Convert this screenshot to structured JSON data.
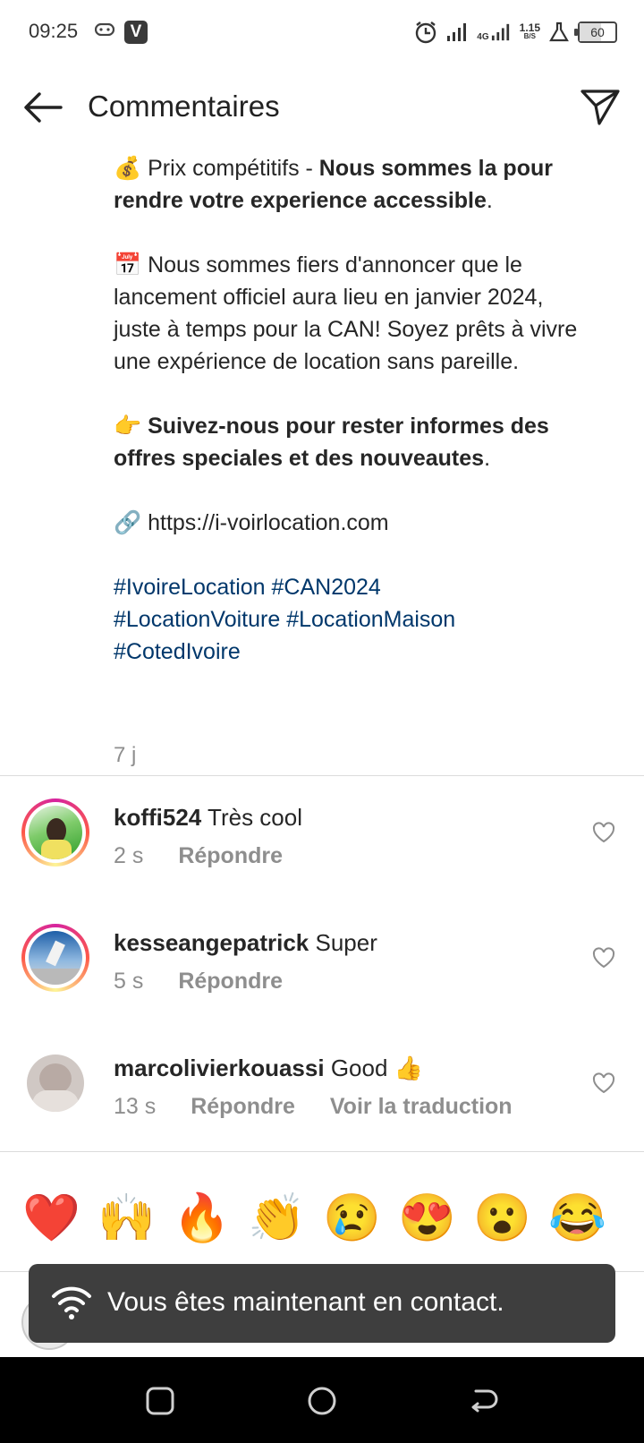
{
  "status_bar": {
    "time": "09:25",
    "app_icon_label": "V",
    "network_type": "4G",
    "speed_value": "1.15",
    "speed_unit": "B/S",
    "battery": "60",
    "icons": [
      "gamepad-icon",
      "alarm-icon",
      "signal-icon",
      "signal-4g-icon",
      "flask-icon",
      "battery-icon"
    ]
  },
  "header": {
    "title": "Commentaires",
    "back_icon": "arrow-left-icon",
    "send_icon": "paper-plane-icon"
  },
  "caption": {
    "p1_emoji": "💰",
    "p1_plain": "Prix compétitifs - ",
    "p1_bold": "Nous sommes la pour rendre votre experience accessible",
    "p1_end": ".",
    "p2_emoji": "📅",
    "p2_text": "Nous sommes fiers d'annoncer que le lancement officiel aura lieu en janvier 2024, juste à temps pour la CAN! Soyez prêts à vivre une expérience de location sans pareille.",
    "p3_emoji": "👉",
    "p3_bold": "Suivez-nous pour rester informes des offres speciales et des nouveautes",
    "p3_end": ".",
    "p4_emoji": "🔗",
    "p4_link": "https://i-voirlocation.com",
    "hashtags_line1": "#IvoireLocation #CAN2024",
    "hashtags_line2": "#LocationVoiture #LocationMaison",
    "hashtags_line3": "#CotedIvoire",
    "time_ago": "7 j"
  },
  "comments": [
    {
      "username": "koffi524",
      "text": "Très cool",
      "time": "2 s",
      "reply_label": "Répondre",
      "like_icon": "heart-outline-icon"
    },
    {
      "username": "kesseangepatrick",
      "text": "Super",
      "time": "5 s",
      "reply_label": "Répondre",
      "like_icon": "heart-outline-icon"
    },
    {
      "username": "marcolivierkouassi",
      "text": "Good 👍",
      "time": "13 s",
      "reply_label": "Répondre",
      "translate_label": "Voir la traduction",
      "like_icon": "heart-outline-icon"
    }
  ],
  "emoji_bar": [
    "❤️",
    "🙌",
    "🔥",
    "👏",
    "😢",
    "😍",
    "😮",
    "😂"
  ],
  "toast": {
    "text": "Vous êtes maintenant en contact.",
    "icon": "wifi-icon"
  },
  "nav_bar": {
    "buttons": [
      "recents-button",
      "home-button",
      "back-button"
    ]
  },
  "colors": {
    "hashtag": "#00376b",
    "secondary_text": "#8e8e8e",
    "toast_bg": "#3e3e3e",
    "nav_bg": "#000000"
  }
}
